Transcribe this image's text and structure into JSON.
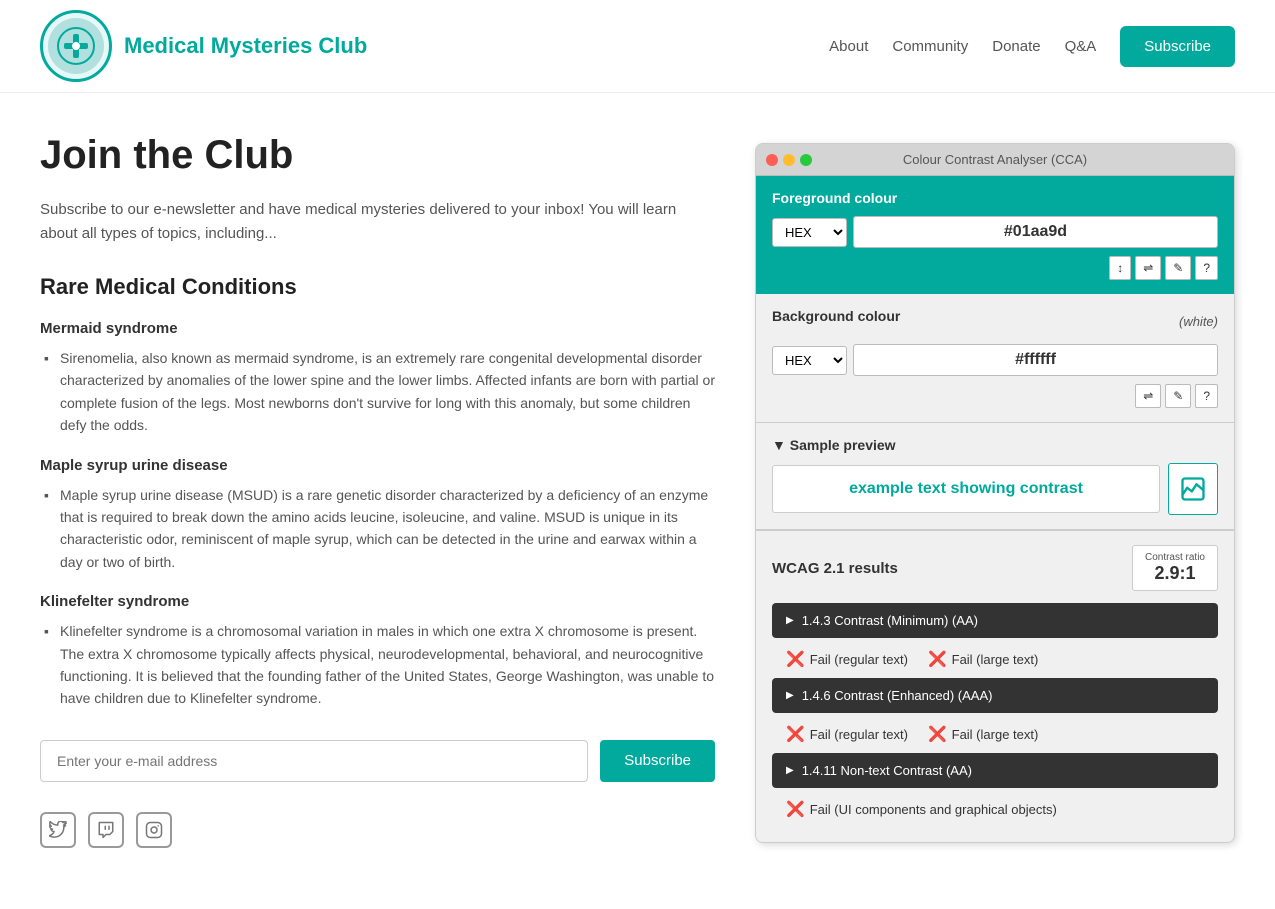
{
  "header": {
    "site_title": "Medical Mysteries Club",
    "logo_emoji": "🏥",
    "nav": {
      "about": "About",
      "community": "Community",
      "donate": "Donate",
      "qa": "Q&A",
      "subscribe": "Subscribe"
    }
  },
  "main": {
    "heading": "Join the Club",
    "intro": "Subscribe to our e-newsletter and have medical mysteries delivered to your inbox! You will learn about all types of topics, including...",
    "section_heading": "Rare Medical Conditions",
    "conditions": [
      {
        "title": "Mermaid syndrome",
        "description": "Sirenomelia, also known as mermaid syndrome, is an extremely rare congenital developmental disorder characterized by anomalies of the lower spine and the lower limbs. Affected infants are born with partial or complete fusion of the legs. Most newborns don't survive for long with this anomaly, but some children defy the odds."
      },
      {
        "title": "Maple syrup urine disease",
        "description": "Maple syrup urine disease (MSUD) is a rare genetic disorder characterized by a deficiency of an enzyme that is required to break down the amino acids leucine, isoleucine, and valine. MSUD is unique in its characteristic odor, reminiscent of maple syrup, which can be detected in the urine and earwax within a day or two of birth."
      },
      {
        "title": "Klinefelter syndrome",
        "description": "Klinefelter syndrome is a chromosomal variation in males in which one extra X chromosome is present. The extra X chromosome typically affects physical, neurodevelopmental, behavioral, and neurocognitive functioning. It is believed that the founding father of the United States, George Washington, was unable to have children due to Klinefelter syndrome."
      }
    ],
    "email_placeholder": "Enter your e-mail address",
    "subscribe_btn": "Subscribe"
  },
  "cca": {
    "title": "Colour Contrast Analyser (CCA)",
    "foreground_label": "Foreground colour",
    "fg_format": "HEX",
    "fg_value": "#01aa9d",
    "fg_tools": [
      "↕",
      "⇌",
      "✎",
      "?"
    ],
    "background_label": "Background colour",
    "bg_white": "(white)",
    "bg_format": "HEX",
    "bg_value": "#ffffff",
    "bg_tools": [
      "⇌",
      "✎",
      "?"
    ],
    "sample_label": "▼ Sample preview",
    "sample_text": "example text showing contrast",
    "wcag_label": "WCAG 2.1 results",
    "contrast_ratio_label": "Contrast ratio",
    "contrast_ratio_value": "2.9:1",
    "criteria": [
      {
        "id": "1.4.3",
        "label": "1.4.3 Contrast (Minimum) (AA)",
        "results": [
          {
            "label": "Fail (regular text)",
            "pass": false
          },
          {
            "label": "Fail (large text)",
            "pass": false
          }
        ]
      },
      {
        "id": "1.4.6",
        "label": "1.4.6 Contrast (Enhanced) (AAA)",
        "results": [
          {
            "label": "Fail (regular text)",
            "pass": false
          },
          {
            "label": "Fail (large text)",
            "pass": false
          }
        ]
      },
      {
        "id": "1.4.11",
        "label": "1.4.11 Non-text Contrast (AA)",
        "results": [
          {
            "label": "Fail (UI components and graphical objects)",
            "pass": false
          }
        ]
      }
    ]
  },
  "social": {
    "twitter_symbol": "🐦",
    "twitch_symbol": "📺",
    "instagram_symbol": "📷"
  }
}
